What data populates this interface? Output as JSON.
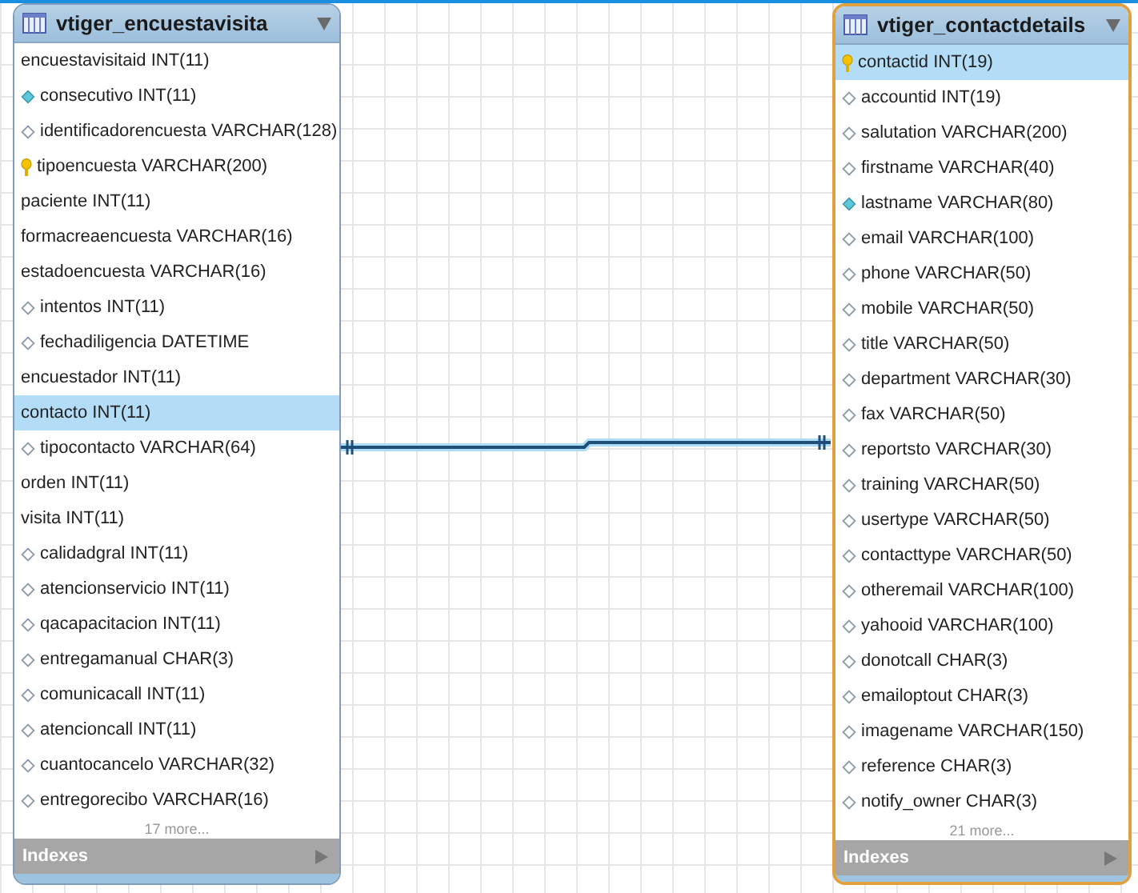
{
  "tables": [
    {
      "title": "vtiger_encuestavisita",
      "selected": false,
      "columns": [
        {
          "text": "encuestavisitaid INT(11)",
          "kind": "plain",
          "selected": false
        },
        {
          "text": "consecutivo INT(11)",
          "kind": "filled",
          "selected": false
        },
        {
          "text": "identificadorencuesta VARCHAR(128)",
          "kind": "diamond",
          "selected": false
        },
        {
          "text": "tipoencuesta VARCHAR(200)",
          "kind": "key",
          "selected": false
        },
        {
          "text": "paciente INT(11)",
          "kind": "plain",
          "selected": false
        },
        {
          "text": "formacreaencuesta VARCHAR(16)",
          "kind": "plain",
          "selected": false
        },
        {
          "text": "estadoencuesta VARCHAR(16)",
          "kind": "plain",
          "selected": false
        },
        {
          "text": "intentos INT(11)",
          "kind": "diamond",
          "selected": false
        },
        {
          "text": "fechadiligencia DATETIME",
          "kind": "diamond",
          "selected": false
        },
        {
          "text": "encuestador INT(11)",
          "kind": "plain",
          "selected": false
        },
        {
          "text": "contacto INT(11)",
          "kind": "plain",
          "selected": true
        },
        {
          "text": "tipocontacto VARCHAR(64)",
          "kind": "diamond",
          "selected": false
        },
        {
          "text": "orden INT(11)",
          "kind": "plain",
          "selected": false
        },
        {
          "text": "visita INT(11)",
          "kind": "plain",
          "selected": false
        },
        {
          "text": "calidadgral INT(11)",
          "kind": "diamond",
          "selected": false
        },
        {
          "text": "atencionservicio INT(11)",
          "kind": "diamond",
          "selected": false
        },
        {
          "text": "qacapacitacion INT(11)",
          "kind": "diamond",
          "selected": false
        },
        {
          "text": "entregamanual CHAR(3)",
          "kind": "diamond",
          "selected": false
        },
        {
          "text": "comunicacall INT(11)",
          "kind": "diamond",
          "selected": false
        },
        {
          "text": "atencioncall INT(11)",
          "kind": "diamond",
          "selected": false
        },
        {
          "text": "cuantocancelo VARCHAR(32)",
          "kind": "diamond",
          "selected": false
        },
        {
          "text": "entregorecibo VARCHAR(16)",
          "kind": "diamond",
          "selected": false
        }
      ],
      "more": "17 more...",
      "indexes": "Indexes"
    },
    {
      "title": "vtiger_contactdetails",
      "selected": true,
      "columns": [
        {
          "text": "contactid INT(19)",
          "kind": "key",
          "selected": true
        },
        {
          "text": "accountid INT(19)",
          "kind": "diamond",
          "selected": false
        },
        {
          "text": "salutation VARCHAR(200)",
          "kind": "diamond",
          "selected": false
        },
        {
          "text": "firstname VARCHAR(40)",
          "kind": "diamond",
          "selected": false
        },
        {
          "text": "lastname VARCHAR(80)",
          "kind": "filled",
          "selected": false
        },
        {
          "text": "email VARCHAR(100)",
          "kind": "diamond",
          "selected": false
        },
        {
          "text": "phone VARCHAR(50)",
          "kind": "diamond",
          "selected": false
        },
        {
          "text": "mobile VARCHAR(50)",
          "kind": "diamond",
          "selected": false
        },
        {
          "text": "title VARCHAR(50)",
          "kind": "diamond",
          "selected": false
        },
        {
          "text": "department VARCHAR(30)",
          "kind": "diamond",
          "selected": false
        },
        {
          "text": "fax VARCHAR(50)",
          "kind": "diamond",
          "selected": false
        },
        {
          "text": "reportsto VARCHAR(30)",
          "kind": "diamond",
          "selected": false
        },
        {
          "text": "training VARCHAR(50)",
          "kind": "diamond",
          "selected": false
        },
        {
          "text": "usertype VARCHAR(50)",
          "kind": "diamond",
          "selected": false
        },
        {
          "text": "contacttype VARCHAR(50)",
          "kind": "diamond",
          "selected": false
        },
        {
          "text": "otheremail VARCHAR(100)",
          "kind": "diamond",
          "selected": false
        },
        {
          "text": "yahooid VARCHAR(100)",
          "kind": "diamond",
          "selected": false
        },
        {
          "text": "donotcall CHAR(3)",
          "kind": "diamond",
          "selected": false
        },
        {
          "text": "emailoptout CHAR(3)",
          "kind": "diamond",
          "selected": false
        },
        {
          "text": "imagename VARCHAR(150)",
          "kind": "diamond",
          "selected": false
        },
        {
          "text": "reference CHAR(3)",
          "kind": "diamond",
          "selected": false
        },
        {
          "text": "notify_owner CHAR(3)",
          "kind": "diamond",
          "selected": false
        }
      ],
      "more": "21 more...",
      "indexes": "Indexes"
    }
  ]
}
